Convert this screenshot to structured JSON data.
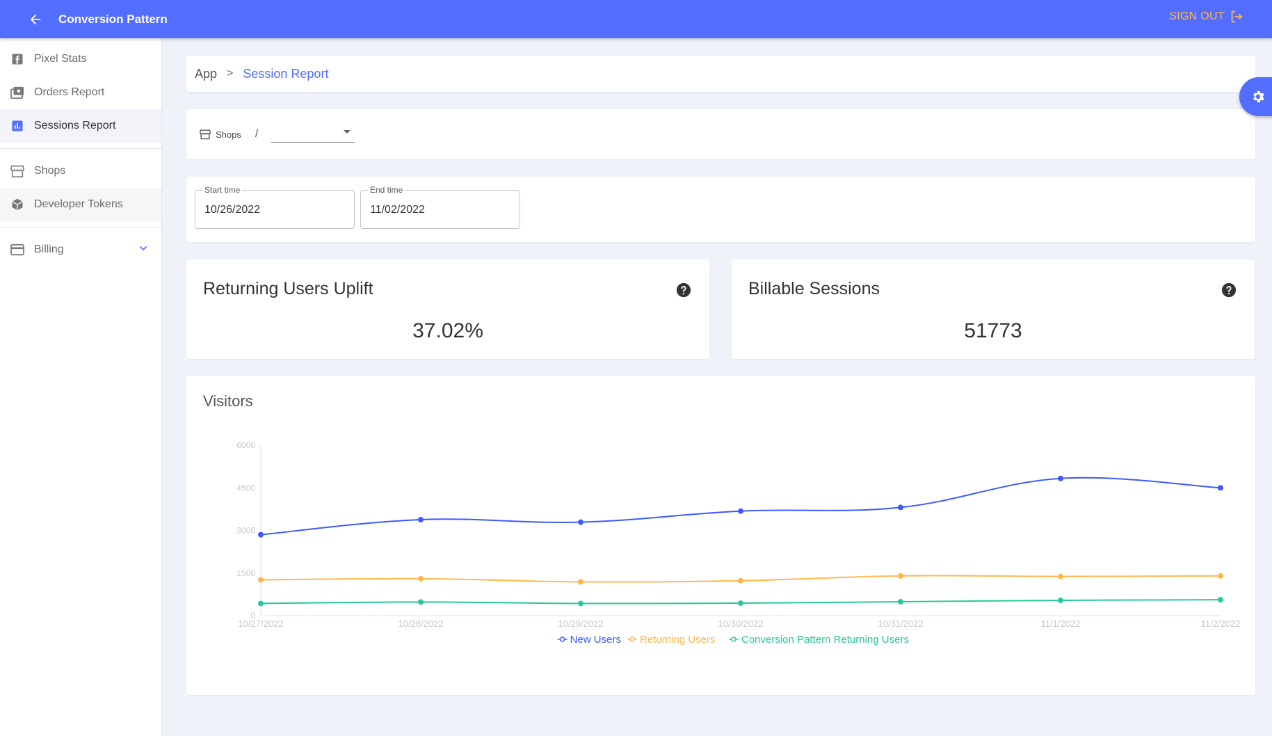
{
  "appbar": {
    "title": "Conversion Pattern",
    "signout_label": "SIGN OUT"
  },
  "sidebar": {
    "items": [
      {
        "label": "Pixel Stats",
        "icon": "facebook-icon"
      },
      {
        "label": "Orders Report",
        "icon": "orders-icon"
      },
      {
        "label": "Sessions Report",
        "icon": "bar-chart-icon",
        "active": true
      },
      {
        "label": "Shops",
        "icon": "storefront-icon"
      },
      {
        "label": "Developer Tokens",
        "icon": "cube-icon"
      },
      {
        "label": "Billing",
        "icon": "credit-card-icon",
        "expandable": true
      }
    ]
  },
  "breadcrumb": {
    "root": "App",
    "separator": ">",
    "current": "Session Report"
  },
  "filters": {
    "shops_label": "Shops",
    "separator": "/",
    "shop_selected": "",
    "start_label": "Start time",
    "start_value": "10/26/2022",
    "end_label": "End time",
    "end_value": "11/02/2022"
  },
  "stats": {
    "uplift": {
      "title": "Returning Users Uplift",
      "value": "37.02%"
    },
    "billable": {
      "title": "Billable Sessions",
      "value": "51773"
    }
  },
  "colors": {
    "primary": "#536dfe",
    "new_users": "#3d5afe",
    "returning_users": "#ffb74d",
    "cp_returning_users": "#26c99a"
  },
  "chart_data": {
    "type": "line",
    "title": "Visitors",
    "x": [
      "10/27/2022",
      "10/28/2022",
      "10/29/2022",
      "10/30/2022",
      "10/31/2022",
      "11/1/2022",
      "11/2/2022"
    ],
    "yticks": [
      "0",
      "1500",
      "3000",
      "4500",
      "6000"
    ],
    "ylim": [
      0,
      6000
    ],
    "grid": false,
    "legend": "bottom",
    "series": [
      {
        "name": "New Users",
        "color": "#3d5afe",
        "values": [
          2850,
          3380,
          3290,
          3680,
          3810,
          4830,
          4500
        ]
      },
      {
        "name": "Returning Users",
        "color": "#ffb74d",
        "values": [
          1260,
          1300,
          1190,
          1230,
          1400,
          1380,
          1400
        ]
      },
      {
        "name": "Conversion Pattern Returning Users",
        "color": "#26c99a",
        "values": [
          430,
          480,
          430,
          440,
          490,
          540,
          560
        ]
      }
    ]
  }
}
